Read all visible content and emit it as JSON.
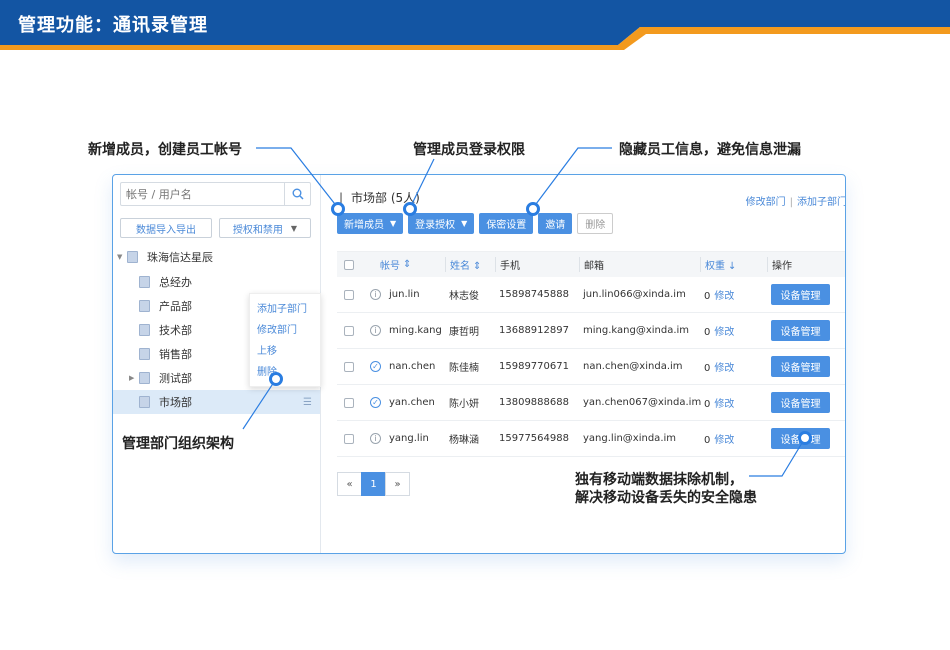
{
  "header": {
    "title": "管理功能：通讯录管理"
  },
  "colors": {
    "banner_blue": "#1355a3",
    "banner_orange": "#f39a1e",
    "accent": "#4a90e2"
  },
  "callouts": {
    "create": "新增成员，创建员工帐号",
    "login": "管理成员登录权限",
    "hide": "隐藏员工信息，避免信息泄漏",
    "org": "管理部门组织架构",
    "wipe_line1": "独有移动端数据抹除机制，",
    "wipe_line2": "解决移动设备丢失的安全隐患"
  },
  "sidebar": {
    "search_placeholder": "帐号 / 用户名",
    "search_icon": "search-icon",
    "import_export": "数据导入导出",
    "auth_disable": "授权和禁用",
    "root": "珠海信达星辰",
    "departments": [
      "总经办",
      "产品部",
      "技术部",
      "销售部",
      "测试部",
      "市场部"
    ],
    "context_menu": [
      "添加子部门",
      "修改部门",
      "上移",
      "删除"
    ]
  },
  "main": {
    "dept_title": "市场部 (5人)",
    "edit_dept": "修改部门",
    "add_sub_dept": "添加子部门",
    "toolbar": {
      "add_member": "新增成员",
      "login_auth": "登录授权",
      "privacy": "保密设置",
      "invite": "邀请",
      "delete": "删除"
    },
    "columns": [
      "帐号",
      "姓名",
      "手机",
      "邮箱",
      "权重",
      "操作"
    ],
    "rows": [
      {
        "account": "jun.lin",
        "name": "林志俊",
        "phone": "15898745888",
        "email": "jun.lin066@xinda.im",
        "weight": "0",
        "edit": "修改",
        "action": "设备管理",
        "status": "i"
      },
      {
        "account": "ming.kang",
        "name": "康哲明",
        "phone": "13688912897",
        "email": "ming.kang@xinda.im",
        "weight": "0",
        "edit": "修改",
        "action": "设备管理",
        "status": "i"
      },
      {
        "account": "nan.chen",
        "name": "陈佳楠",
        "phone": "15989770671",
        "email": "nan.chen@xinda.im",
        "weight": "0",
        "edit": "修改",
        "action": "设备管理",
        "status": "✓"
      },
      {
        "account": "yan.chen",
        "name": "陈小妍",
        "phone": "13809888688",
        "email": "yan.chen067@xinda.im",
        "weight": "0",
        "edit": "修改",
        "action": "设备管理",
        "status": "✓"
      },
      {
        "account": "yang.lin",
        "name": "杨琳涵",
        "phone": "15977564988",
        "email": "yang.lin@xinda.im",
        "weight": "0",
        "edit": "修改",
        "action": "设备管理",
        "status": "i"
      }
    ],
    "pager": {
      "prev": "«",
      "current": "1",
      "next": "»"
    }
  }
}
